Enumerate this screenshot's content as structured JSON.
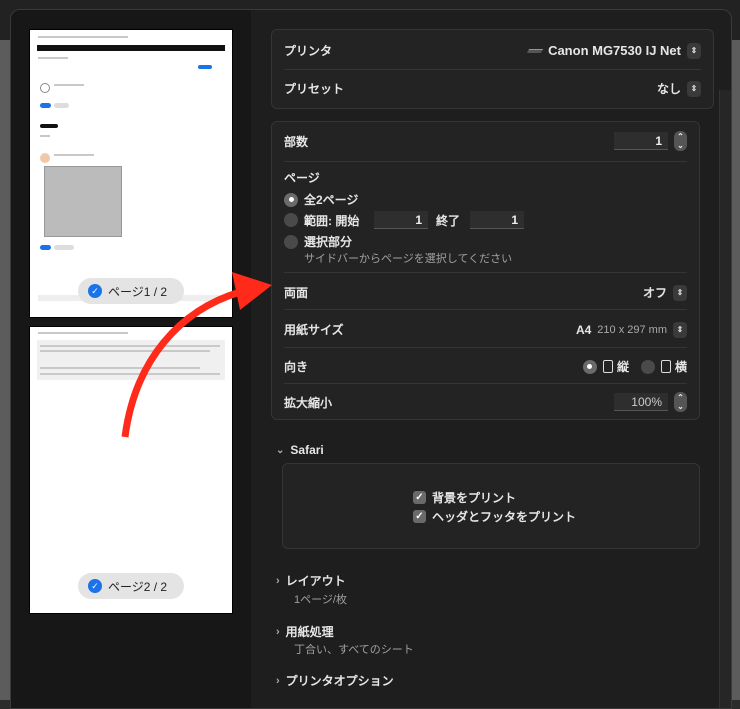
{
  "sidebar": {
    "pages": [
      {
        "label": "ページ1 / 2",
        "checked": true
      },
      {
        "label": "ページ2 / 2",
        "checked": true
      }
    ]
  },
  "printer": {
    "label": "プリンタ",
    "value": "Canon MG7530 IJ Net"
  },
  "preset": {
    "label": "プリセット",
    "value": "なし"
  },
  "copies": {
    "label": "部数",
    "value": "1"
  },
  "pages": {
    "label": "ページ",
    "all": "全2ページ",
    "range": "範囲: 開始",
    "range_from": "1",
    "range_to_label": "終了",
    "range_to": "1",
    "selection": "選択部分",
    "selection_hint": "サイドバーからページを選択してください",
    "selected": "all"
  },
  "duplex": {
    "label": "両面",
    "value": "オフ"
  },
  "paper": {
    "label": "用紙サイズ",
    "value": "A4",
    "dims": "210 x 297 mm"
  },
  "orientation": {
    "label": "向き",
    "portrait": "縦",
    "landscape": "横",
    "selected": "portrait"
  },
  "scale": {
    "label": "拡大縮小",
    "value": "100%"
  },
  "safari": {
    "title": "Safari",
    "print_backgrounds": "背景をプリント",
    "print_headers": "ヘッダとフッタをプリント"
  },
  "layout": {
    "title": "レイアウト",
    "summary": "1ページ/枚"
  },
  "paper_handling": {
    "title": "用紙処理",
    "summary": "丁合い、すべてのシート"
  },
  "printer_options": {
    "title": "プリンタオプション"
  },
  "colors": {
    "annotation": "#ff2a1a",
    "accent": "#1a73e8"
  }
}
